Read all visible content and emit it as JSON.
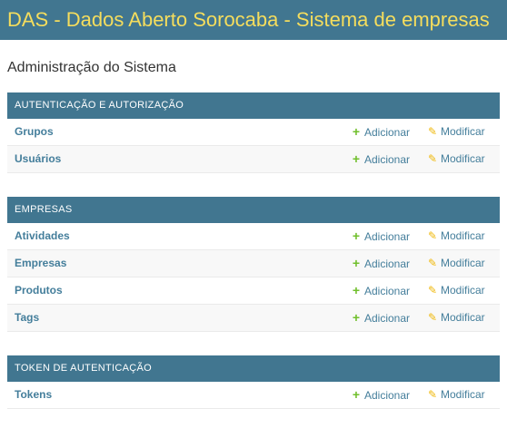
{
  "header": {
    "title": "DAS - Dados Aberto Sorocaba - Sistema de empresas"
  },
  "page": {
    "title": "Administração do Sistema"
  },
  "modules": [
    {
      "caption": "Autenticação e Autorização",
      "models": [
        {
          "name": "Grupos",
          "add_label": "Adicionar",
          "change_label": "Modificar"
        },
        {
          "name": "Usuários",
          "add_label": "Adicionar",
          "change_label": "Modificar"
        }
      ]
    },
    {
      "caption": "Empresas",
      "models": [
        {
          "name": "Atividades",
          "add_label": "Adicionar",
          "change_label": "Modificar"
        },
        {
          "name": "Empresas",
          "add_label": "Adicionar",
          "change_label": "Modificar"
        },
        {
          "name": "Produtos",
          "add_label": "Adicionar",
          "change_label": "Modificar"
        },
        {
          "name": "Tags",
          "add_label": "Adicionar",
          "change_label": "Modificar"
        }
      ]
    },
    {
      "caption": "Token de Autenticação",
      "models": [
        {
          "name": "Tokens",
          "add_label": "Adicionar",
          "change_label": "Modificar"
        }
      ]
    }
  ],
  "icons": {
    "add": "plus-icon",
    "change": "pencil-icon"
  },
  "colors": {
    "header_bg": "#417690",
    "header_title": "#f5dd5d",
    "link": "#447e9b",
    "add_icon": "#70bf2b",
    "change_icon": "#efb80b"
  }
}
